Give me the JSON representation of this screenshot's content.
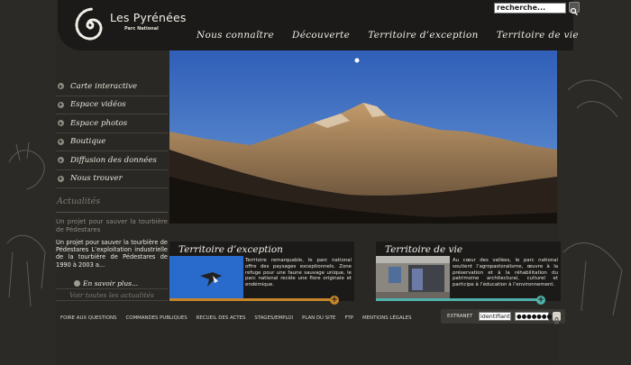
{
  "brand": {
    "title": "Les Pyrénées",
    "subtitle": "Parc National"
  },
  "search": {
    "value": "recherche..."
  },
  "topnav": [
    "Nous connaître",
    "Découverte",
    "Territoire d’exception",
    "Territoire de vie"
  ],
  "leftnav": [
    "Carte interactive",
    "Espace vidéos",
    "Espace photos",
    "Boutique",
    "Diffusion des données",
    "Nous trouver"
  ],
  "news": {
    "heading": "Actualités",
    "title": "Un projet pour sauver la tourbière de Pédestares",
    "body": "Un projet pour sauver la tourbière de Pédestares L’exploitation industrielle de la tourbière de Pédestares de 1990 à 2003 a...",
    "more": "En savoir plus...",
    "all": "Voir toutes les actualités"
  },
  "box_exception": {
    "title": "Territoire d’exception",
    "text": "Territoire remarquable, le parc national offre des paysages exceptionnels. Zone refuge pour une faune sauvage unique, le parc national recèle une flore originale et endémique.",
    "plus": "+"
  },
  "box_vie": {
    "title": "Territoire de vie",
    "text": "Au cœur des vallées, le parc national soutient l’agropastoralisme, œuvre à la préservation et à la réhabilitation du patrimoine architectural, culturel et participe à l’éducation à l’environnement.",
    "plus": "+"
  },
  "footer": [
    "FOIRE AUX QUESTIONS",
    "COMMANDES PUBLIQUES",
    "RECUEIL DES ACTES",
    "STAGES/EMPLOI",
    "PLAN DU SITE",
    "FTP",
    "MENTIONS LÉGALES"
  ],
  "extranet": {
    "label": "EXTRANET",
    "login_value": "identifiant",
    "password_value": "●●●●●●●"
  },
  "colors": {
    "background": "#2a2824",
    "panel": "#1b1a18",
    "accent_orange": "#c8862a",
    "accent_teal": "#4fb3ac",
    "sky": "#2d5fb0"
  }
}
